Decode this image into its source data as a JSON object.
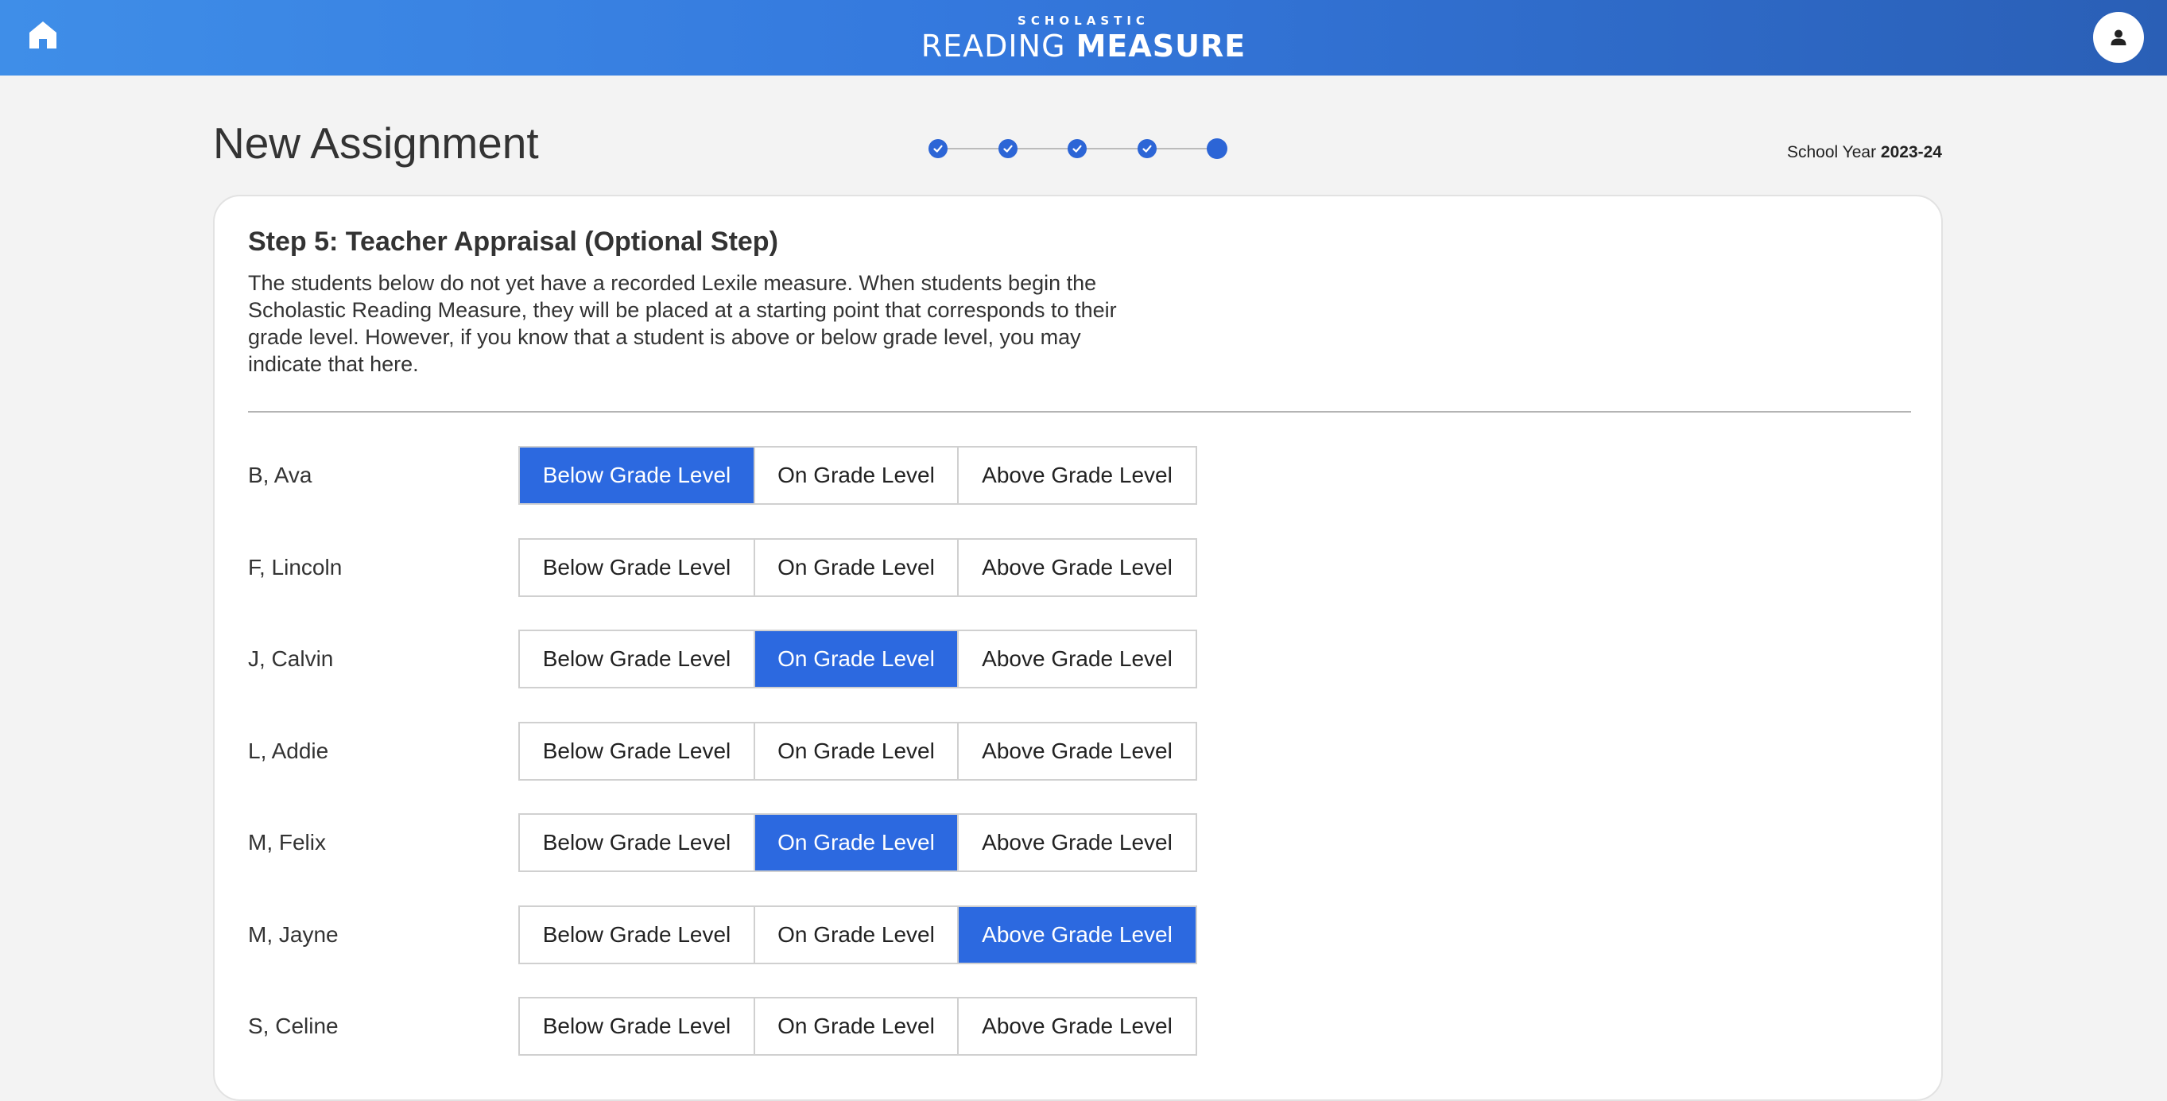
{
  "header": {
    "brand_top": "SCHOLASTIC",
    "brand_light": "READING",
    "brand_bold": "MEASURE",
    "home_icon": "home-icon",
    "user_icon": "user-icon"
  },
  "page": {
    "title": "New Assignment",
    "school_year_label": "School Year",
    "school_year_value": "2023-24"
  },
  "stepper": {
    "total_steps": 5,
    "completed_steps": 4,
    "current_step": 5
  },
  "step": {
    "heading": "Step 5: Teacher Appraisal (Optional Step)",
    "description": "The students below do not yet have a recorded Lexile measure. When students begin the Scholastic Reading Measure, they will be placed at a starting point that corresponds to their grade level. However, if you know that a student is above or below grade level, you may indicate that here."
  },
  "options": [
    "Below Grade Level",
    "On Grade Level",
    "Above Grade Level"
  ],
  "students": [
    {
      "name": "B, Ava",
      "selected": 0
    },
    {
      "name": "F, Lincoln",
      "selected": null
    },
    {
      "name": "J, Calvin",
      "selected": 1
    },
    {
      "name": "L, Addie",
      "selected": null
    },
    {
      "name": "M, Felix",
      "selected": 1
    },
    {
      "name": "M, Jayne",
      "selected": 2
    },
    {
      "name": "S, Celine",
      "selected": null
    }
  ],
  "colors": {
    "accent": "#2c69e0",
    "header_start": "#3f8ee8",
    "header_end": "#2a5fb6"
  }
}
